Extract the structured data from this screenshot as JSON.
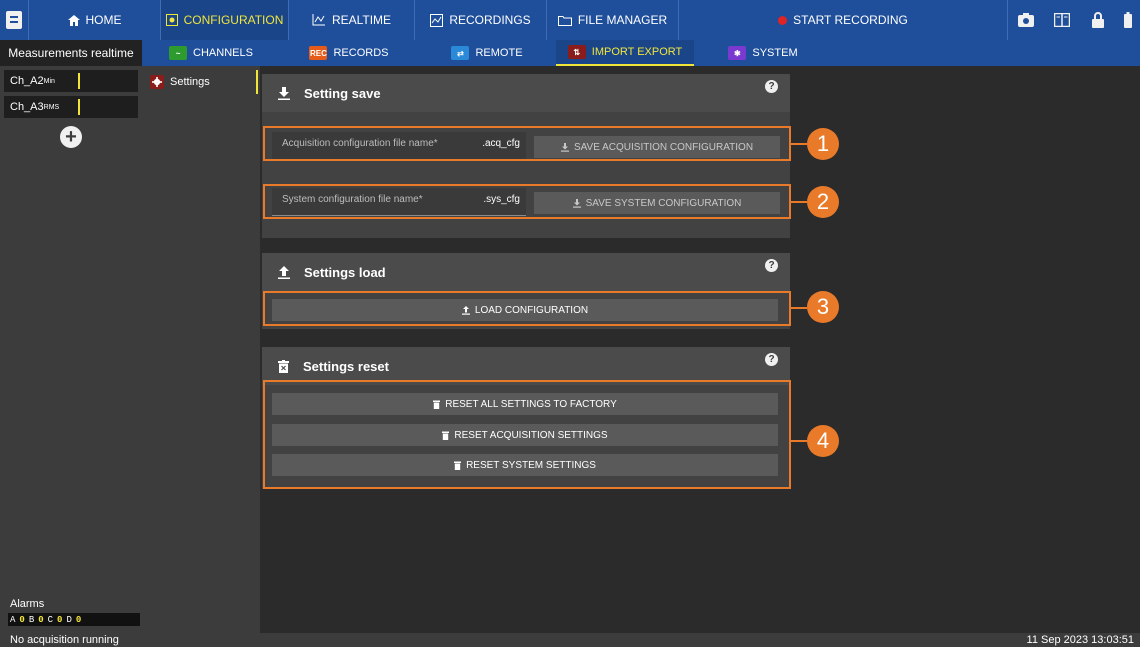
{
  "topbar": {
    "nav": [
      {
        "label": "HOME",
        "icon": "home-icon"
      },
      {
        "label": "CONFIGURATION",
        "icon": "configuration-icon"
      },
      {
        "label": "REALTIME",
        "icon": "realtime-icon"
      },
      {
        "label": "RECORDINGS",
        "icon": "recordings-icon"
      },
      {
        "label": "FILE MANAGER",
        "icon": "folder-icon"
      }
    ],
    "record_label": "START RECORDING",
    "right_icons": [
      "camera-icon",
      "book-icon",
      "lock-icon",
      "battery-icon"
    ]
  },
  "left_panel": {
    "title": "Measurements realtime",
    "channels": [
      {
        "name": "Ch_A2",
        "sub": "Min"
      },
      {
        "name": "Ch_A3",
        "sub": "RMS"
      }
    ],
    "alarms_label": "Alarms",
    "alarm_counts": [
      {
        "key": "A",
        "value": "0"
      },
      {
        "key": "B",
        "value": "0"
      },
      {
        "key": "C",
        "value": "0"
      },
      {
        "key": "D",
        "value": "0"
      }
    ]
  },
  "subtabs": [
    {
      "label": "CHANNELS",
      "icon_color": "#2e9b2e"
    },
    {
      "label": "RECORDS",
      "icon_color": "#e55b1a"
    },
    {
      "label": "REMOTE",
      "icon_color": "#2a8ad8"
    },
    {
      "label": "IMPORT EXPORT",
      "icon_color": "#8a1c1c"
    },
    {
      "label": "SYSTEM",
      "icon_color": "#7a3ad0"
    }
  ],
  "settings_nav": {
    "label": "Settings"
  },
  "settings_save": {
    "title": "Setting save",
    "acq_field_placeholder": "Acquisition configuration file name*",
    "acq_suffix": ".acq_cfg",
    "acq_button": "SAVE ACQUISITION CONFIGURATION",
    "sys_field_placeholder": "System configuration file name*",
    "sys_suffix": ".sys_cfg",
    "sys_button": "SAVE SYSTEM CONFIGURATION"
  },
  "settings_load": {
    "title": "Settings load",
    "button": "LOAD CONFIGURATION"
  },
  "settings_reset": {
    "title": "Settings reset",
    "buttons": [
      "RESET ALL SETTINGS TO FACTORY",
      "RESET ACQUISITION SETTINGS",
      "RESET SYSTEM SETTINGS"
    ]
  },
  "callouts": [
    "1",
    "2",
    "3",
    "4"
  ],
  "status": {
    "left": "No acquisition running",
    "right": "11 Sep 2023 13:03:51"
  },
  "colors": {
    "accent": "#1f4f9b",
    "highlight": "#f2e53a",
    "callout": "#e97a2a",
    "record": "#e02424"
  }
}
